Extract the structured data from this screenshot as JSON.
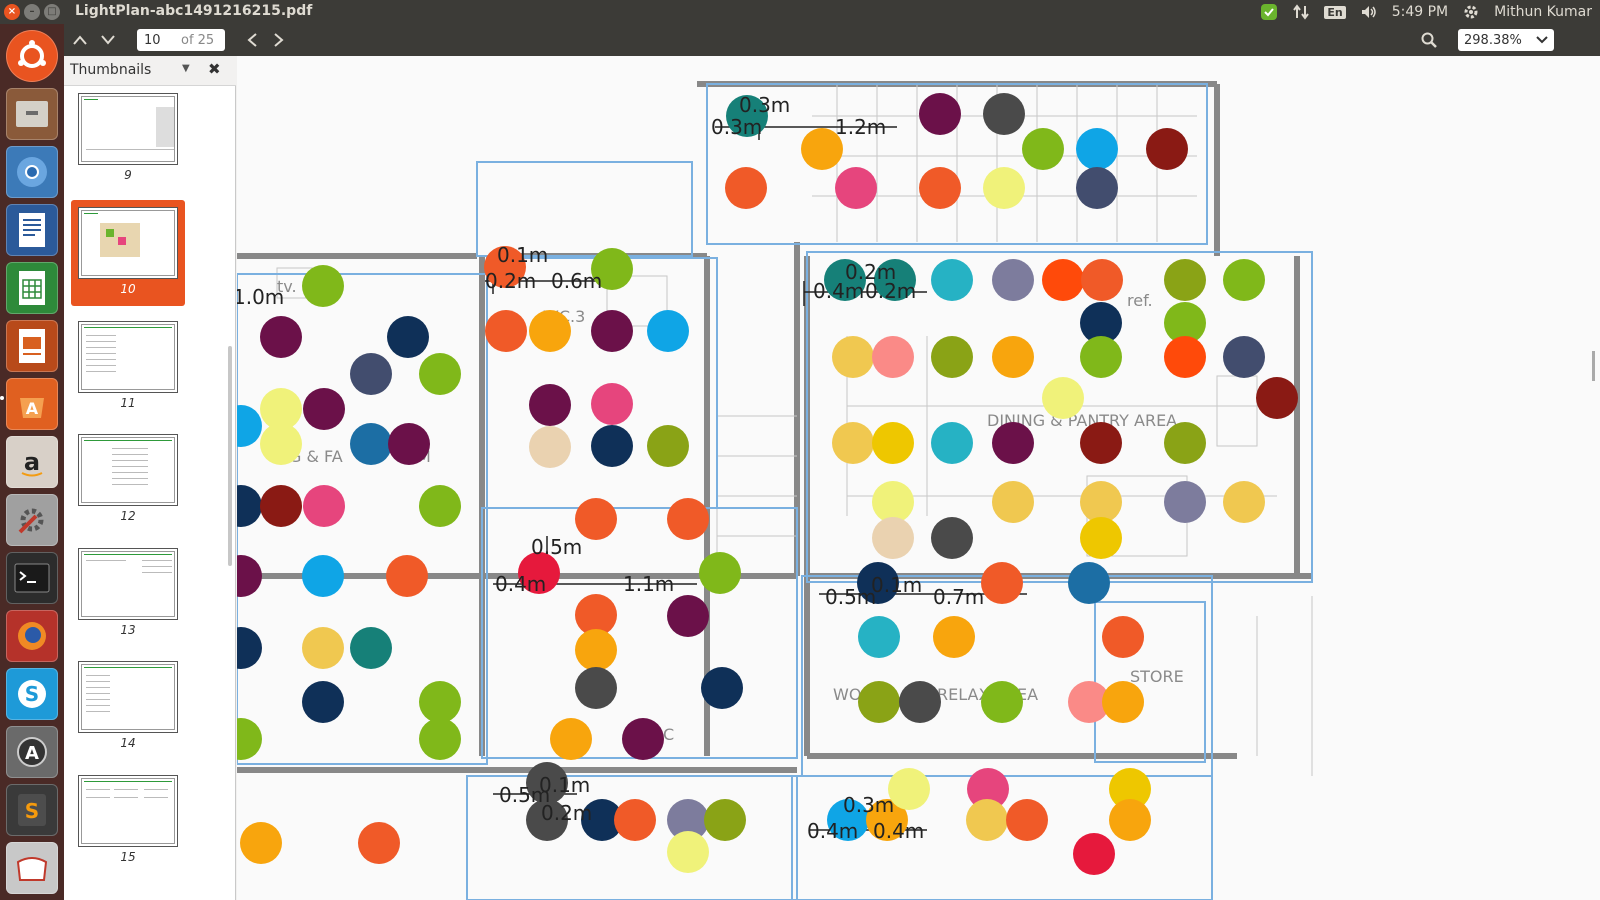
{
  "window": {
    "title": "LightPlan-abc1491216215.pdf",
    "close_glyph": "×",
    "min_glyph": "–",
    "max_glyph": "□"
  },
  "panel": {
    "language": "En",
    "time": "5:49 PM",
    "user": "Mithun Kumar",
    "icons": [
      "update-icon",
      "network-icon",
      "keyboard-icon",
      "volume-icon",
      "gear-icon"
    ]
  },
  "toolbar": {
    "page_current": "10",
    "page_total": "of 25",
    "zoom": "298.38%",
    "icons": [
      "chevron-up-icon",
      "chevron-down-icon",
      "arrow-left-icon",
      "arrow-right-icon",
      "search-icon"
    ]
  },
  "launcher": {
    "apps": [
      "ubuntu-icon",
      "files-icon",
      "chromium-icon",
      "writer-icon",
      "calc-icon",
      "impress-icon",
      "software-center-icon",
      "amazon-icon",
      "settings-icon",
      "terminal-icon",
      "firefox-icon",
      "skype-icon",
      "updater-icon",
      "sublime-icon",
      "bottom-app-icon"
    ]
  },
  "sidebar": {
    "title": "Thumbnails",
    "pages": [
      "9",
      "10",
      "11",
      "12",
      "13",
      "14",
      "15"
    ],
    "active_page": "10"
  },
  "floorplan": {
    "dimension_labels": [
      "0.3m",
      "0.3m",
      "1.2m",
      "0.1m",
      "0.2m",
      "0.6m",
      "0.2m",
      "0.4m",
      "0.2m",
      "1.0m",
      "0.5m",
      "0.4m",
      "1.1m",
      "0.5m",
      "0.1m",
      "0.7m",
      "0.1m",
      "0.5m",
      "0.2m",
      "0.3m",
      "0.4m",
      "0.4m"
    ],
    "room_labels": [
      "tv.",
      "WC.3",
      "ref.",
      "DINING & PANTRY AREA",
      "NG & FA",
      "M",
      "STORE",
      "WO",
      "RELAX",
      "EA",
      "C"
    ],
    "colors": {
      "green": "#80b81a",
      "plum": "#6b1149",
      "navy": "#0f3058",
      "slate": "#424d6e",
      "sky": "#0fa5e6",
      "lemon": "#f0f27a",
      "teal_blue": "#1c6ea4",
      "maroon": "#8a1a14",
      "pink": "#e6457d",
      "orange_red": "#f05a28",
      "orange": "#f8a50d",
      "sand": "#f0c850",
      "teal_green": "#168078",
      "salmon": "#fa8a87",
      "olive": "#8aa316",
      "cyan": "#26b2c4",
      "grey": "#4a4a4a",
      "lavender": "#7d7c9d",
      "gold": "#eec700",
      "beige": "#ead2b0",
      "crimson": "#e6193c",
      "bright_red": "#ff4a0a"
    }
  }
}
